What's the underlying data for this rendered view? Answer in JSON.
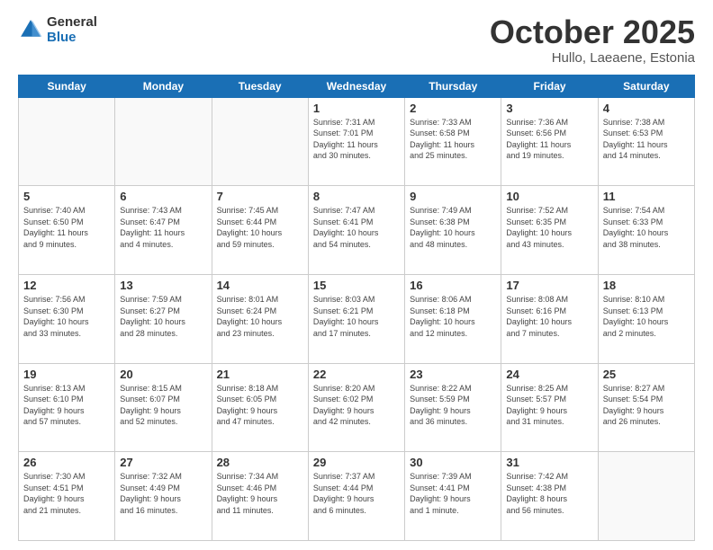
{
  "header": {
    "logo_line1": "General",
    "logo_line2": "Blue",
    "month_title": "October 2025",
    "subtitle": "Hullo, Laeaene, Estonia"
  },
  "days_of_week": [
    "Sunday",
    "Monday",
    "Tuesday",
    "Wednesday",
    "Thursday",
    "Friday",
    "Saturday"
  ],
  "weeks": [
    [
      {
        "num": "",
        "info": ""
      },
      {
        "num": "",
        "info": ""
      },
      {
        "num": "",
        "info": ""
      },
      {
        "num": "1",
        "info": "Sunrise: 7:31 AM\nSunset: 7:01 PM\nDaylight: 11 hours\nand 30 minutes."
      },
      {
        "num": "2",
        "info": "Sunrise: 7:33 AM\nSunset: 6:58 PM\nDaylight: 11 hours\nand 25 minutes."
      },
      {
        "num": "3",
        "info": "Sunrise: 7:36 AM\nSunset: 6:56 PM\nDaylight: 11 hours\nand 19 minutes."
      },
      {
        "num": "4",
        "info": "Sunrise: 7:38 AM\nSunset: 6:53 PM\nDaylight: 11 hours\nand 14 minutes."
      }
    ],
    [
      {
        "num": "5",
        "info": "Sunrise: 7:40 AM\nSunset: 6:50 PM\nDaylight: 11 hours\nand 9 minutes."
      },
      {
        "num": "6",
        "info": "Sunrise: 7:43 AM\nSunset: 6:47 PM\nDaylight: 11 hours\nand 4 minutes."
      },
      {
        "num": "7",
        "info": "Sunrise: 7:45 AM\nSunset: 6:44 PM\nDaylight: 10 hours\nand 59 minutes."
      },
      {
        "num": "8",
        "info": "Sunrise: 7:47 AM\nSunset: 6:41 PM\nDaylight: 10 hours\nand 54 minutes."
      },
      {
        "num": "9",
        "info": "Sunrise: 7:49 AM\nSunset: 6:38 PM\nDaylight: 10 hours\nand 48 minutes."
      },
      {
        "num": "10",
        "info": "Sunrise: 7:52 AM\nSunset: 6:35 PM\nDaylight: 10 hours\nand 43 minutes."
      },
      {
        "num": "11",
        "info": "Sunrise: 7:54 AM\nSunset: 6:33 PM\nDaylight: 10 hours\nand 38 minutes."
      }
    ],
    [
      {
        "num": "12",
        "info": "Sunrise: 7:56 AM\nSunset: 6:30 PM\nDaylight: 10 hours\nand 33 minutes."
      },
      {
        "num": "13",
        "info": "Sunrise: 7:59 AM\nSunset: 6:27 PM\nDaylight: 10 hours\nand 28 minutes."
      },
      {
        "num": "14",
        "info": "Sunrise: 8:01 AM\nSunset: 6:24 PM\nDaylight: 10 hours\nand 23 minutes."
      },
      {
        "num": "15",
        "info": "Sunrise: 8:03 AM\nSunset: 6:21 PM\nDaylight: 10 hours\nand 17 minutes."
      },
      {
        "num": "16",
        "info": "Sunrise: 8:06 AM\nSunset: 6:18 PM\nDaylight: 10 hours\nand 12 minutes."
      },
      {
        "num": "17",
        "info": "Sunrise: 8:08 AM\nSunset: 6:16 PM\nDaylight: 10 hours\nand 7 minutes."
      },
      {
        "num": "18",
        "info": "Sunrise: 8:10 AM\nSunset: 6:13 PM\nDaylight: 10 hours\nand 2 minutes."
      }
    ],
    [
      {
        "num": "19",
        "info": "Sunrise: 8:13 AM\nSunset: 6:10 PM\nDaylight: 9 hours\nand 57 minutes."
      },
      {
        "num": "20",
        "info": "Sunrise: 8:15 AM\nSunset: 6:07 PM\nDaylight: 9 hours\nand 52 minutes."
      },
      {
        "num": "21",
        "info": "Sunrise: 8:18 AM\nSunset: 6:05 PM\nDaylight: 9 hours\nand 47 minutes."
      },
      {
        "num": "22",
        "info": "Sunrise: 8:20 AM\nSunset: 6:02 PM\nDaylight: 9 hours\nand 42 minutes."
      },
      {
        "num": "23",
        "info": "Sunrise: 8:22 AM\nSunset: 5:59 PM\nDaylight: 9 hours\nand 36 minutes."
      },
      {
        "num": "24",
        "info": "Sunrise: 8:25 AM\nSunset: 5:57 PM\nDaylight: 9 hours\nand 31 minutes."
      },
      {
        "num": "25",
        "info": "Sunrise: 8:27 AM\nSunset: 5:54 PM\nDaylight: 9 hours\nand 26 minutes."
      }
    ],
    [
      {
        "num": "26",
        "info": "Sunrise: 7:30 AM\nSunset: 4:51 PM\nDaylight: 9 hours\nand 21 minutes."
      },
      {
        "num": "27",
        "info": "Sunrise: 7:32 AM\nSunset: 4:49 PM\nDaylight: 9 hours\nand 16 minutes."
      },
      {
        "num": "28",
        "info": "Sunrise: 7:34 AM\nSunset: 4:46 PM\nDaylight: 9 hours\nand 11 minutes."
      },
      {
        "num": "29",
        "info": "Sunrise: 7:37 AM\nSunset: 4:44 PM\nDaylight: 9 hours\nand 6 minutes."
      },
      {
        "num": "30",
        "info": "Sunrise: 7:39 AM\nSunset: 4:41 PM\nDaylight: 9 hours\nand 1 minute."
      },
      {
        "num": "31",
        "info": "Sunrise: 7:42 AM\nSunset: 4:38 PM\nDaylight: 8 hours\nand 56 minutes."
      },
      {
        "num": "",
        "info": ""
      }
    ]
  ]
}
